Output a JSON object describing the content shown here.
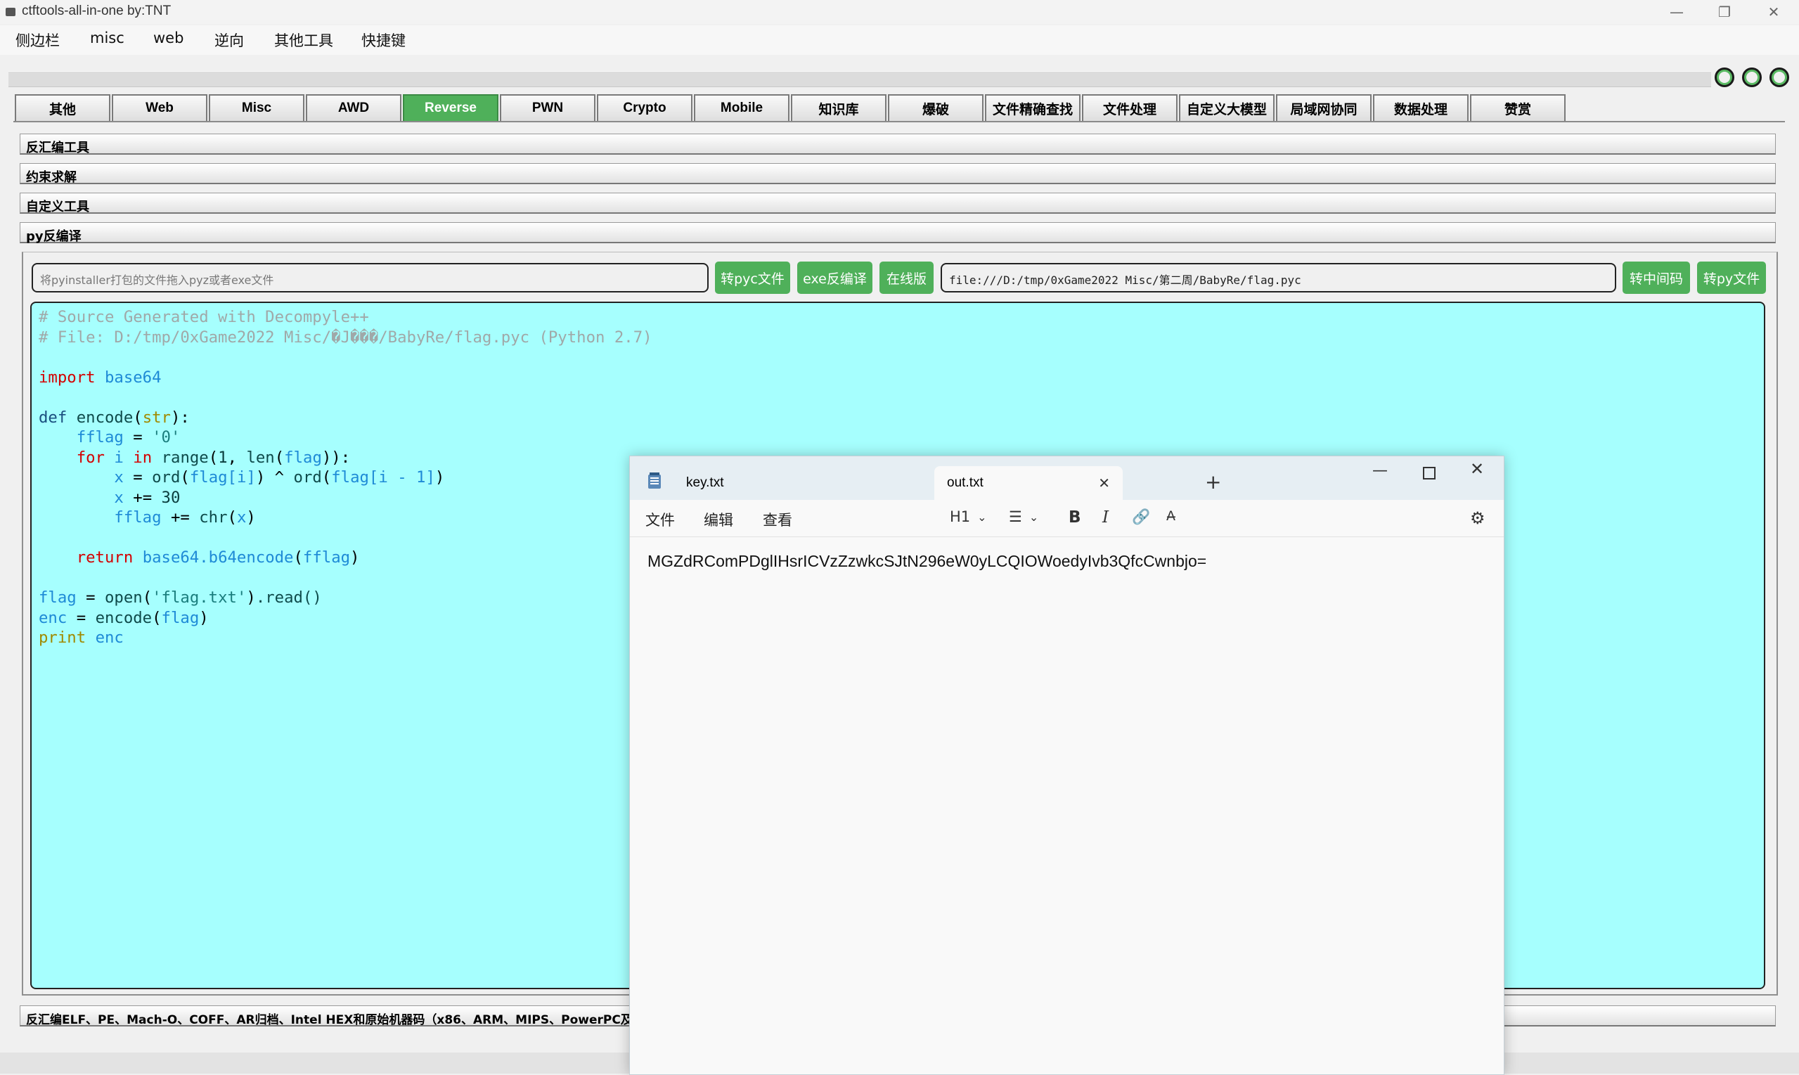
{
  "window": {
    "title": "ctftools-all-in-one   by:TNT",
    "minimize_glyph": "—",
    "maximize_glyph": "❐",
    "close_glyph": "✕"
  },
  "menubar": [
    "侧边栏",
    "misc",
    "web",
    "逆向",
    "其他工具",
    "快捷键"
  ],
  "tabs": [
    "其他",
    "Web",
    "Misc",
    "AWD",
    "Reverse",
    "PWN",
    "Crypto",
    "Mobile",
    "知识库",
    "爆破",
    "文件精确查找",
    "文件处理",
    "自定义大模型",
    "局域网协同",
    "数据处理",
    "赞赏"
  ],
  "active_tab": "Reverse",
  "sections": [
    "反汇编工具",
    "约束求解",
    "自定义工具",
    "py反编译"
  ],
  "pyinstaller_input": {
    "placeholder": "将pyinstaller打包的文件拖入pyz或者exe文件"
  },
  "buttons": {
    "to_pyc": "转pyc文件",
    "exe_decompile": "exe反编译",
    "online": "在线版",
    "to_bytecode": "转中间码",
    "to_py": "转py文件"
  },
  "pyc_path_input": {
    "value": "file:///D:/tmp/0xGame2022 Misc/第二周/BabyRe/flag.pyc"
  },
  "code": {
    "comment_1": "# Source Generated with Decompyle++",
    "comment_2": "# File: D:/tmp/0xGame2022 Misc/�J���/BabyRe/flag.pyc (Python 2.7)",
    "line_import_kw": "import",
    "line_import_mod": "base64",
    "def_kw": "def",
    "def_name": "encode",
    "def_param": "str",
    "fflag": "fflag",
    "init_str": "'0'",
    "for_kw": "for",
    "i": "i",
    "in_kw": "in",
    "range": "range",
    "len": "len",
    "flag": "flag",
    "x": "x",
    "ord": "ord",
    "flag_i": "flag[i]",
    "flag_i1": "flag[i - 1]",
    "n1": "1",
    "n30": "30",
    "chr": "chr",
    "return_kw": "return",
    "b64call": "base64.b64encode",
    "open": "open",
    "fname": "'flag.txt'",
    "read": ".read()",
    "enc": "enc",
    "print_kw": "print"
  },
  "status_section": "反汇编ELF、PE、Mach-O、COFF、AR归档、Intel HEX和原始机器码（x86、ARM、MIPS、PowerPC及",
  "notepad": {
    "tabs": [
      "key.txt",
      "out.txt"
    ],
    "active_tab": "out.txt",
    "menu": [
      "文件",
      "编辑",
      "查看"
    ],
    "heading_selector": "H1",
    "content": "MGZdRComPDglIHsrICVzZzwkcSJtN296eW0yLCQIOWoedyIvb3QfcCwnbjo="
  }
}
